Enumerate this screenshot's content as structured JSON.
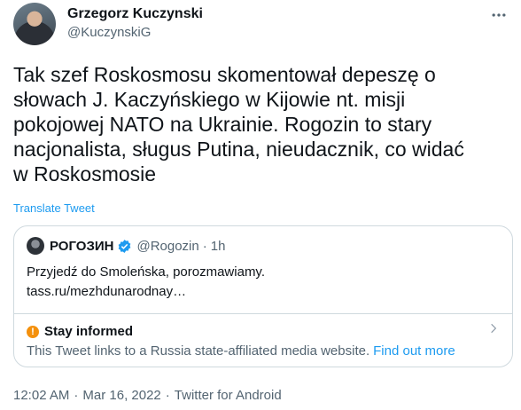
{
  "author": {
    "name": "Grzegorz Kuczynski",
    "handle": "@KuczynskiG"
  },
  "tweet": {
    "text": "Tak szef Roskosmosu skomentował depeszę o\nsłowach J. Kaczyńskiego w Kijowie nt. misji\npokojowej NATO na Ukrainie. Rogozin to stary\nnacjonalista, sługus Putina, nieudacznik, co widać\nw Roskosmosie",
    "translate_label": "Translate Tweet"
  },
  "quoted": {
    "name": "РОГОЗИН",
    "handle": "@Rogozin",
    "dot": "·",
    "time": "1h",
    "line1": "Przyjedź do Smoleńska, porozmawiamy.",
    "line2": "tass.ru/mezhdunarodnay…",
    "notice_title": "Stay informed",
    "notice_body": "This Tweet links to a Russia state-affiliated media website.",
    "notice_link": "Find out more"
  },
  "meta": {
    "time": "12:02 AM",
    "dot1": "·",
    "date": "Mar 16, 2022",
    "dot2": "·",
    "source": "Twitter for Android"
  },
  "icons": [
    "more-icon",
    "verified-badge-icon",
    "info-icon",
    "chevron-right-icon"
  ],
  "colors": {
    "link": "#1d9bf0",
    "secondary_text": "#536471",
    "notice": "#f4900c",
    "border": "#cfd9de"
  }
}
